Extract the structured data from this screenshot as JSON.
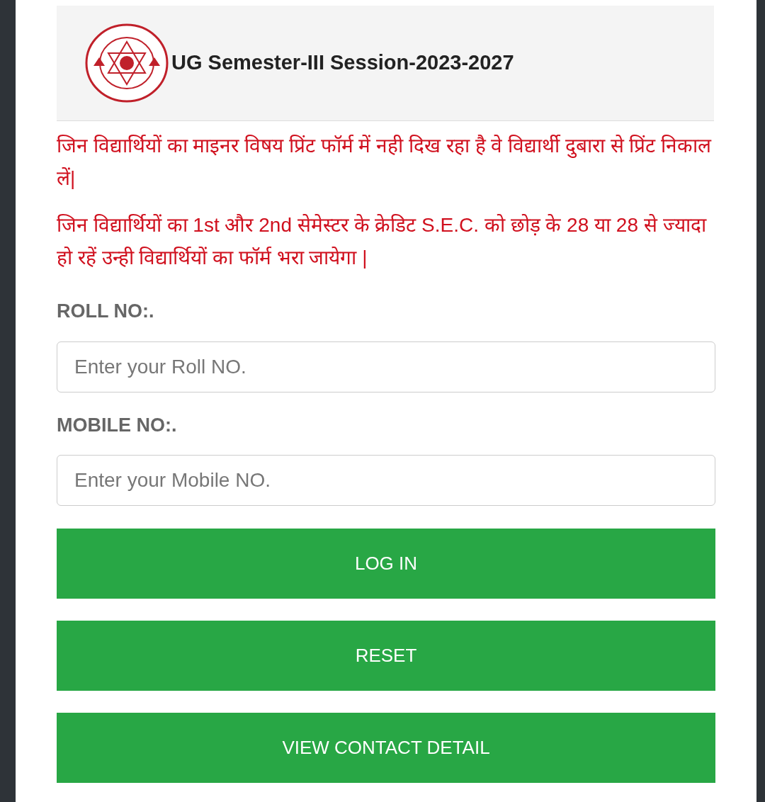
{
  "header": {
    "title": "UG Semester-III Session-2023-2027"
  },
  "notices": [
    "जिन विद्यार्थियों का माइनर विषय प्रिंट फॉर्म में नही दिख रहा है वे विद्यार्थी दुबारा से प्रिंट निकाल लें|",
    "जिन विद्यार्थियों का 1st और 2nd सेमेस्टर के क्रेडिट S.E.C. को छोड़ के 28 या 28 से ज्यादा हो रहें उन्ही विद्यार्थियों का फॉर्म भरा जायेगा |"
  ],
  "fields": [
    {
      "label": "ROLL NO:.",
      "placeholder": "Enter your Roll NO."
    },
    {
      "label": "MOBILE NO:.",
      "placeholder": "Enter your Mobile NO."
    }
  ],
  "buttons": [
    "LOG IN",
    "RESET",
    "VIEW CONTACT DETAIL"
  ]
}
